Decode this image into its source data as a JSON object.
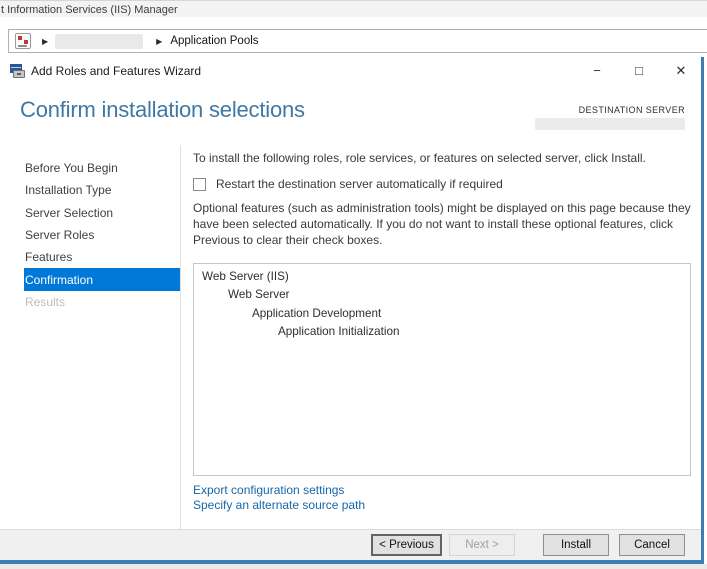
{
  "colors": {
    "accent": "#0078d7",
    "window_border_blue": "#3e7fb1",
    "header_title_blue": "#3e79a5",
    "link_blue": "#1767a8",
    "footer_gray": "#f0f0f0"
  },
  "iis": {
    "titlebar_text": "t Information Services (IIS) Manager",
    "breadcrumb": {
      "arrow_glyph": "▶",
      "location": "Application Pools"
    }
  },
  "wizard": {
    "titlebar": {
      "title": "Add Roles and Features Wizard",
      "minimize_glyph": "−",
      "maximize_glyph": "□",
      "close_glyph": "✕"
    },
    "header": {
      "title": "Confirm installation selections",
      "destination_label": "DESTINATION SERVER"
    },
    "nav": {
      "items": [
        {
          "label": "Before You Begin",
          "state": "enabled"
        },
        {
          "label": "Installation Type",
          "state": "enabled"
        },
        {
          "label": "Server Selection",
          "state": "enabled"
        },
        {
          "label": "Server Roles",
          "state": "enabled"
        },
        {
          "label": "Features",
          "state": "enabled"
        },
        {
          "label": "Confirmation",
          "state": "selected"
        },
        {
          "label": "Results",
          "state": "disabled"
        }
      ]
    },
    "content": {
      "intro": "To install the following roles, role services, or features on selected server, click Install.",
      "restart_checkbox": {
        "label": "Restart the destination server automatically if required",
        "checked": false
      },
      "optional_note": "Optional features (such as administration tools) might be displayed on this page because they have been selected automatically. If you do not want to install these optional features, click Previous to clear their check boxes.",
      "selection_tree": [
        {
          "label": "Web Server (IIS)",
          "level": 0
        },
        {
          "label": "Web Server",
          "level": 1
        },
        {
          "label": "Application Development",
          "level": 2
        },
        {
          "label": "Application Initialization",
          "level": 3
        }
      ],
      "links": [
        "Export configuration settings",
        "Specify an alternate source path"
      ]
    },
    "footer": {
      "buttons": [
        {
          "label": "< Previous",
          "state": "focused"
        },
        {
          "label": "Next >",
          "state": "disabled"
        },
        {
          "label": "Install",
          "state": "enabled"
        },
        {
          "label": "Cancel",
          "state": "enabled"
        }
      ]
    }
  }
}
